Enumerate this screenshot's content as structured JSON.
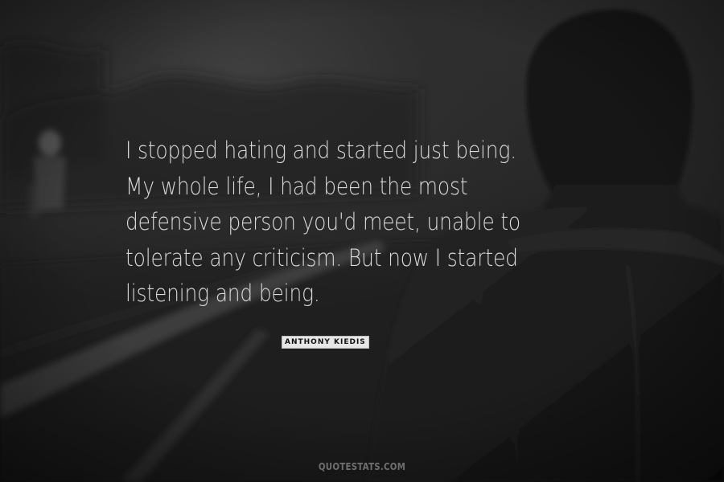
{
  "quote": {
    "lines": [
      "I stopped hating and started just being.",
      "My whole life, I had been the most",
      "defensive person you'd meet, unable to",
      "tolerate any criticism. But now I started",
      "listening and being."
    ]
  },
  "author": "ANTHONY KIEDIS",
  "watermark": "QUOTESTATS.COM",
  "colors": {
    "text": "#d9d9d9",
    "background": "#222222",
    "author_badge": "#e6e6e6"
  }
}
